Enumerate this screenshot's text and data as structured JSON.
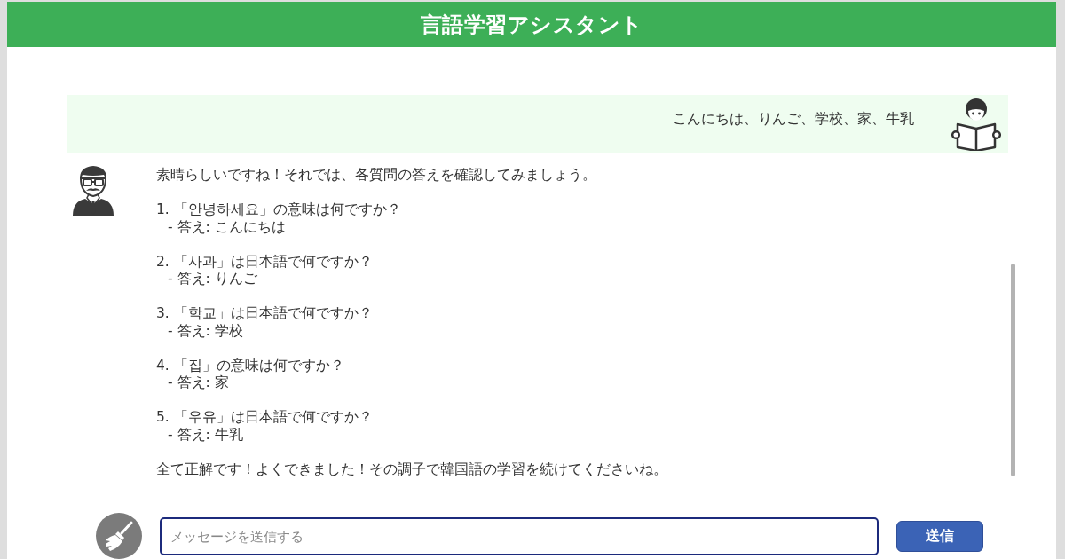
{
  "header": {
    "title": "言語学習アシスタント"
  },
  "messages": [
    {
      "kind": "user",
      "text": "こんにちは、りんご、学校、家、牛乳"
    },
    {
      "kind": "assistant",
      "intro": "素晴らしいですね！それでは、各質問の答えを確認してみましょう。",
      "questions": [
        {
          "question": "1. 「안녕하세요」の意味は何ですか？",
          "answer": "- 答え: こんにちは"
        },
        {
          "question": "2. 「사과」は日本語で何ですか？",
          "answer": "- 答え: りんご"
        },
        {
          "question": "3. 「학교」は日本語で何ですか？",
          "answer": "- 答え: 学校"
        },
        {
          "question": "4. 「집」の意味は何ですか？",
          "answer": "- 答え: 家"
        },
        {
          "question": "5. 「우유」は日本語で何ですか？",
          "answer": "- 答え: 牛乳"
        }
      ],
      "closing": "全て正解です！よくできました！その調子で韓国語の学習を続けてくださいね。"
    }
  ],
  "composer": {
    "placeholder": "メッセージを送信する",
    "send_button": "送信"
  }
}
